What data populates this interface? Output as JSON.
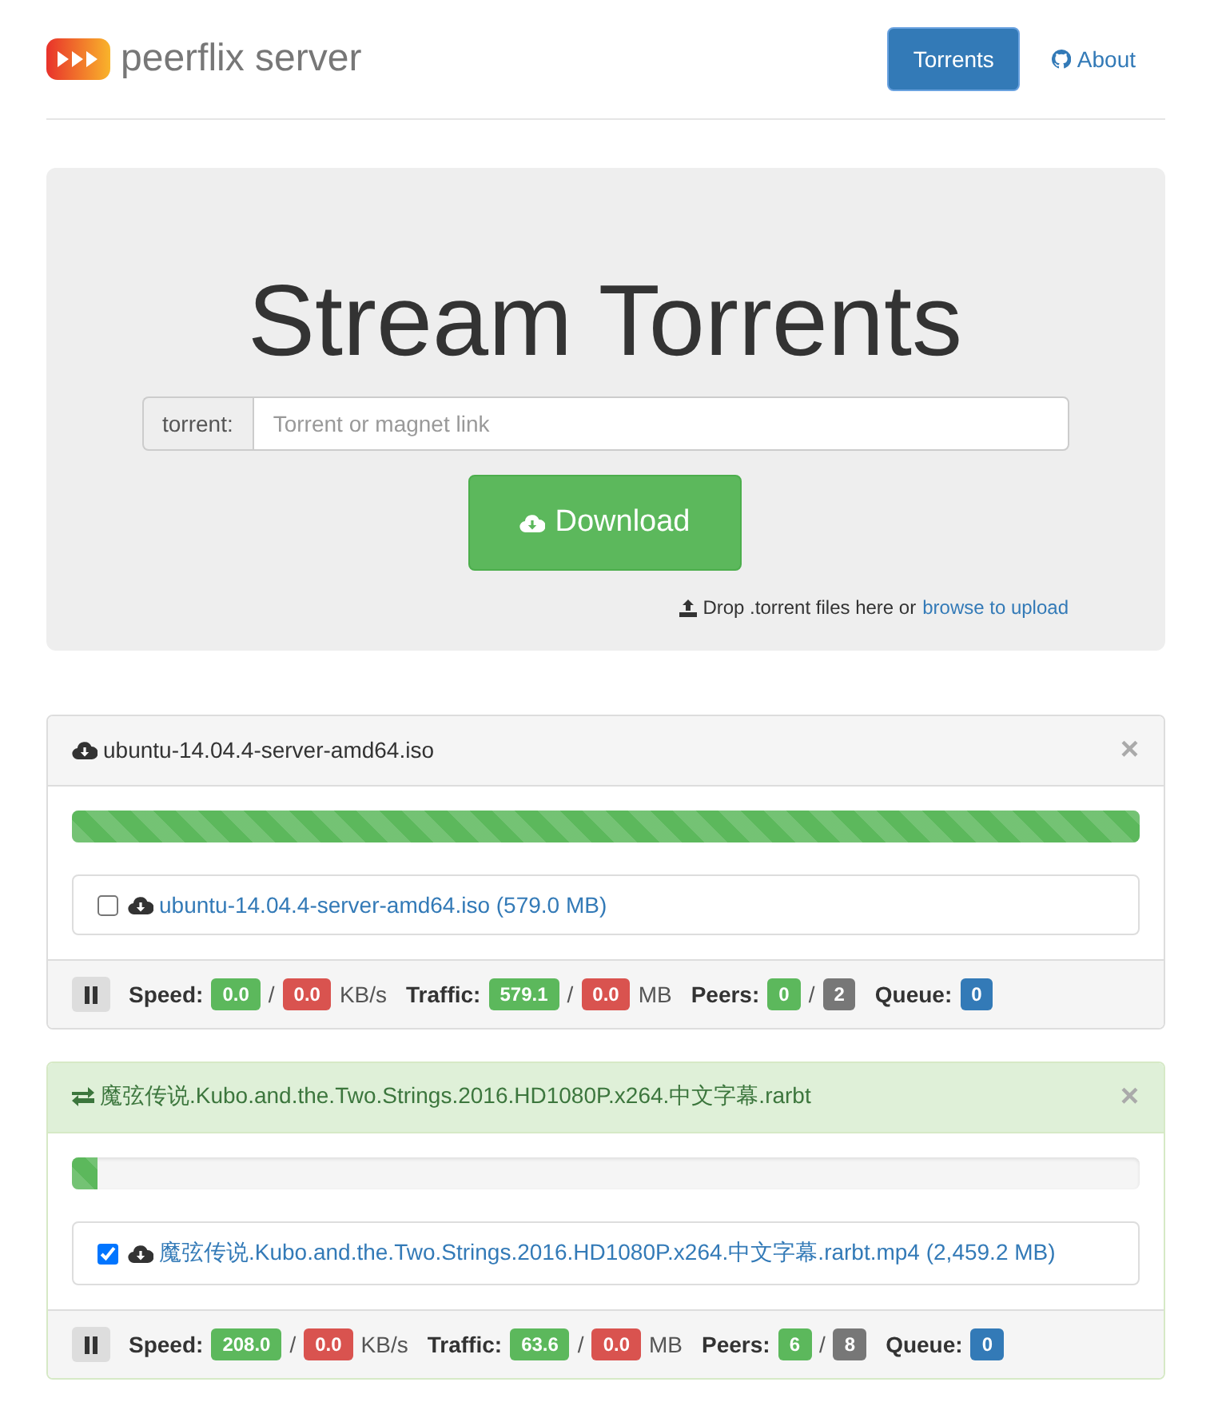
{
  "brand": {
    "name": "peerflix server"
  },
  "nav": [
    {
      "label": "Torrents",
      "selected": true,
      "kind": "tab"
    },
    {
      "label": "About",
      "selected": false,
      "kind": "github"
    }
  ],
  "hero": {
    "title": "Stream Torrents",
    "input_label": "torrent:",
    "placeholder": "Torrent or magnet link",
    "button": "Download",
    "drop_text": "Drop .torrent files here or",
    "drop_link": "browse to upload"
  },
  "torrents": [
    {
      "name": "ubuntu-14.04.4-server-amd64.iso",
      "kind": "ready",
      "close": "×",
      "level": 1,
      "files": [
        {
          "name": "ubuntu-14.04.4-server-amd64.iso (579.0 MB)",
          "checked": false
        }
      ],
      "stats": [
        {
          "label": "Speed:",
          "values": [
            {
              "text": "0.0",
              "color": "#5cb85c"
            },
            {
              "text": "0.0",
              "color": "#d9534f"
            }
          ],
          "separator": "/",
          "unit": "KB/s"
        },
        {
          "label": "Traffic:",
          "values": [
            {
              "text": "579.1",
              "color": "#5cb85c"
            },
            {
              "text": "0.0",
              "color": "#d9534f"
            }
          ],
          "separator": "/",
          "unit": "MB"
        },
        {
          "label": "Peers:",
          "values": [
            {
              "text": "0",
              "color": "#5cb85c"
            },
            {
              "text": "2",
              "color": "#777777"
            }
          ],
          "separator": "/"
        },
        {
          "label": "Queue:",
          "values": [
            {
              "text": "0",
              "color": "#337ab7"
            }
          ]
        }
      ]
    },
    {
      "name": "魔弦传说.Kubo.and.the.Two.Strings.2016.HD1080P.x264.中文字幕.rarbt",
      "kind": "active",
      "close": "×",
      "level": 0.025,
      "files": [
        {
          "name": "魔弦传说.Kubo.and.the.Two.Strings.2016.HD1080P.x264.中文字幕.rarbt.mp4 (2,459.2 MB)",
          "checked": true
        }
      ],
      "stats": [
        {
          "label": "Speed:",
          "values": [
            {
              "text": "208.0",
              "color": "#5cb85c"
            },
            {
              "text": "0.0",
              "color": "#d9534f"
            }
          ],
          "separator": "/",
          "unit": "KB/s"
        },
        {
          "label": "Traffic:",
          "values": [
            {
              "text": "63.6",
              "color": "#5cb85c"
            },
            {
              "text": "0.0",
              "color": "#d9534f"
            }
          ],
          "separator": "/",
          "unit": "MB"
        },
        {
          "label": "Peers:",
          "values": [
            {
              "text": "6",
              "color": "#5cb85c"
            },
            {
              "text": "8",
              "color": "#777777"
            }
          ],
          "separator": "/"
        },
        {
          "label": "Queue:",
          "values": [
            {
              "text": "0",
              "color": "#337ab7"
            }
          ]
        }
      ]
    }
  ]
}
